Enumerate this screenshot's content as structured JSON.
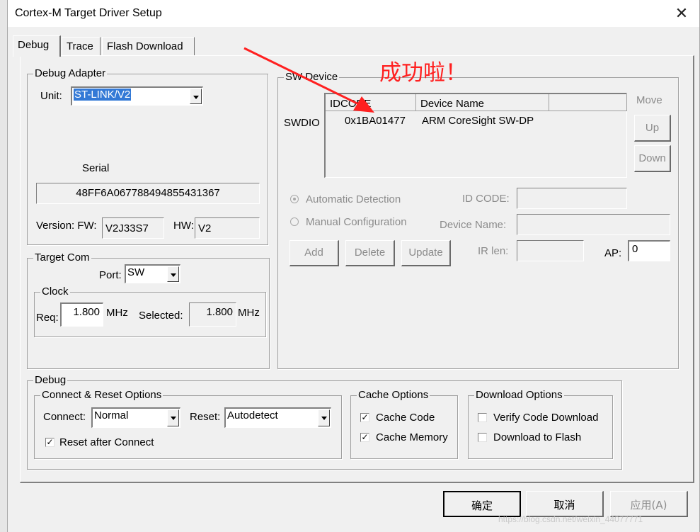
{
  "window": {
    "title": "Cortex-M Target Driver Setup"
  },
  "tabs": [
    "Debug",
    "Trace",
    "Flash Download"
  ],
  "debug_adapter": {
    "legend": "Debug Adapter",
    "unit_label": "Unit:",
    "unit_value": "ST-LINK/V2",
    "serial_label": "Serial",
    "serial_value": "48FF6A067788494855431367",
    "version_label": "Version: FW:",
    "fw_value": "V2J33S7",
    "hw_label": "HW:",
    "hw_value": "V2"
  },
  "target_com": {
    "legend": "Target Com",
    "port_label": "Port:",
    "port_value": "SW",
    "clock_legend": "Clock",
    "req_label": "Req:",
    "req_value": "1.800",
    "req_unit": "MHz",
    "selected_label": "Selected:",
    "selected_value": "1.800",
    "selected_unit": "MHz"
  },
  "sw_device": {
    "legend": "SW Device",
    "swdio_label": "SWDIO",
    "col_idcode": "IDCODE",
    "col_device_name": "Device Name",
    "row_idcode": "0x1BA01477",
    "row_device_name": "ARM CoreSight SW-DP",
    "move_label": "Move",
    "up_label": "Up",
    "down_label": "Down",
    "auto_detection": "Automatic Detection",
    "manual_config": "Manual Configuration",
    "id_code_label": "ID CODE:",
    "device_name_label": "Device Name:",
    "add_label": "Add",
    "delete_label": "Delete",
    "update_label": "Update",
    "ir_len_label": "IR len:",
    "ap_label": "AP:",
    "ap_value": "0"
  },
  "annotation": {
    "text": "成功啦！",
    "color": "#ff2020"
  },
  "debug": {
    "legend": "Debug",
    "connect_reset_legend": "Connect & Reset Options",
    "connect_label": "Connect:",
    "connect_value": "Normal",
    "reset_label": "Reset:",
    "reset_value": "Autodetect",
    "reset_after_connect": "Reset after Connect",
    "cache_legend": "Cache Options",
    "cache_code": "Cache Code",
    "cache_memory": "Cache Memory",
    "download_legend": "Download Options",
    "verify_code_download": "Verify Code Download",
    "download_to_flash": "Download to Flash"
  },
  "footer": {
    "ok": "确定",
    "cancel": "取消",
    "apply": "应用(A)",
    "watermark": "https://blog.csdn.net/weixin_44077771"
  }
}
